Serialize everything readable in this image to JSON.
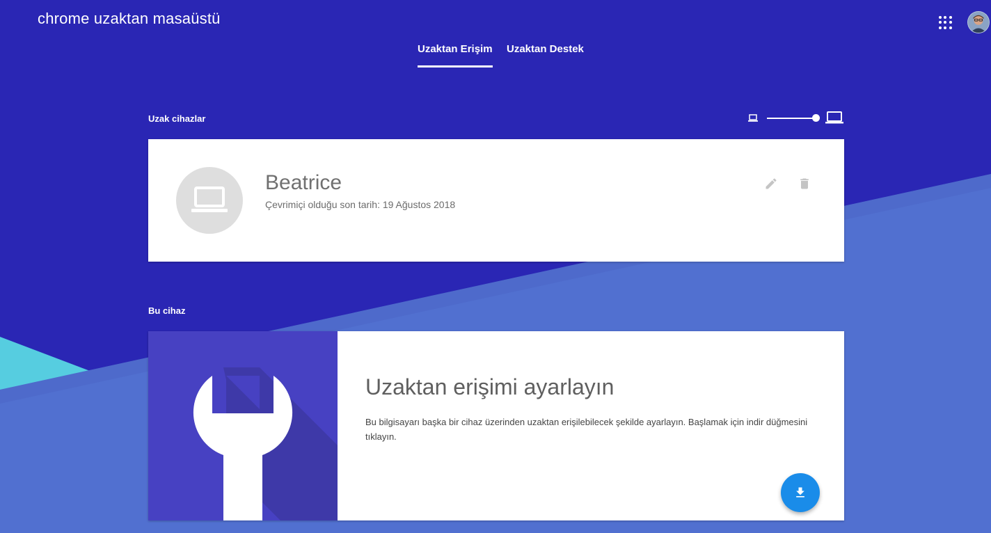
{
  "header": {
    "app_title": "chrome uzaktan masaüstü",
    "apps_icon": "apps-grid-icon",
    "avatar_icon": "account-avatar"
  },
  "tabs": [
    {
      "label": "Uzaktan Erişim",
      "active": true
    },
    {
      "label": "Uzaktan Destek",
      "active": false
    }
  ],
  "remote_devices": {
    "section_label": "Uzak cihazlar",
    "size_slider": {
      "small_icon": "laptop-small-icon",
      "large_icon": "laptop-large-icon",
      "value": 1.0
    },
    "devices": [
      {
        "name": "Beatrice",
        "status": "Çevrimiçi olduğu son tarih: 19 Ağustos 2018",
        "icon": "laptop-icon",
        "actions": [
          "edit-icon",
          "delete-icon"
        ]
      }
    ]
  },
  "this_device": {
    "section_label": "Bu cihaz",
    "title": "Uzaktan erişimi ayarlayın",
    "description": "Bu bilgisayarı başka bir cihaz üzerinden uzaktan erişilebilecek şekilde ayarlayın. Başlamak için indir düğmesini tıklayın.",
    "illustration_icon": "wrench-icon",
    "download_icon": "download-icon"
  },
  "colors": {
    "background": "#2a26b4",
    "accent_blue": "#5170d0",
    "accent_cyan": "#56cde0",
    "fab": "#1a8ce9",
    "illustration_bg": "#4741c2"
  }
}
